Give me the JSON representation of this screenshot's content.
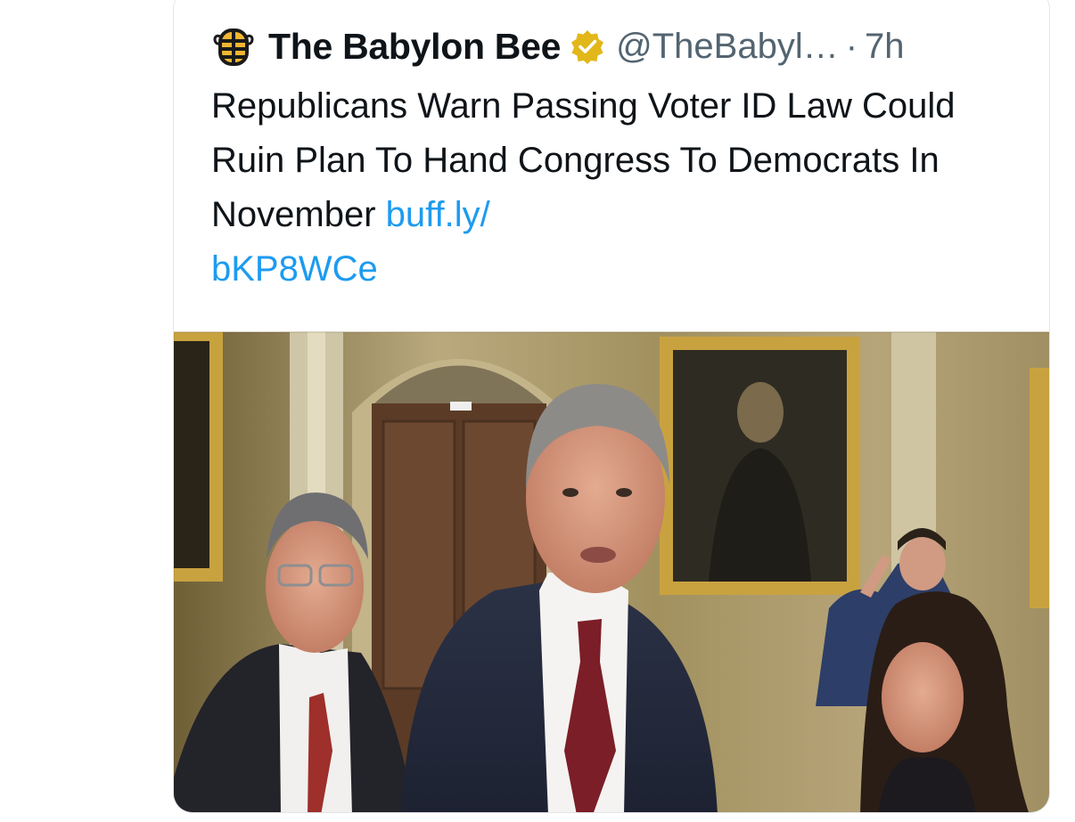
{
  "tweet": {
    "author_name": "The Babylon Bee",
    "handle": "@TheBabyl…",
    "separator": "·",
    "time": "7h",
    "text": "Republicans Warn Passing Voter ID Law Could Ruin Plan To Hand Congress To Democrats In November ",
    "link_line1": "buff.ly/",
    "link_line2": "bKP8WCe"
  },
  "icons": {
    "avatar": "bee-logo-icon",
    "verified": "verified-badge-icon"
  },
  "colors": {
    "link": "#1d9bf0",
    "verified_gold": "#e2b719",
    "text": "#0f1419",
    "secondary": "#536471"
  }
}
